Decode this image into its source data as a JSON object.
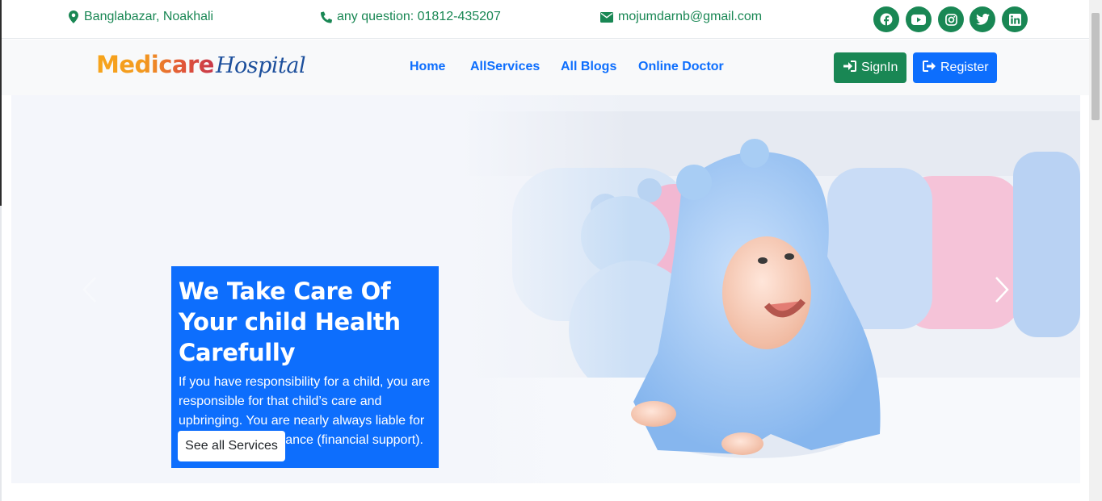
{
  "topbar": {
    "address": "Banglabazar, Noakhali",
    "phone": "any question: 01812-435207",
    "email": "mojumdarnb@gmail.com",
    "social_icons": [
      "facebook-icon",
      "youtube-icon",
      "instagram-icon",
      "twitter-icon",
      "linkedin-icon"
    ]
  },
  "navbar": {
    "brand_part1": "Medicare",
    "brand_part2": "Hospital",
    "links": [
      "Home",
      "AllServices",
      "All Blogs",
      "Online Doctor"
    ],
    "signin_label": "SignIn",
    "register_label": "Register"
  },
  "hero": {
    "title": "We Take Care Of Your child Health Carefully",
    "text": "If you have responsibility for a child, you are responsible for that child’s care and upbringing. You are nearly always liable for the child’s maintenance (financial support).",
    "button_label": "See all Services"
  },
  "colors": {
    "primary": "#0d6efd",
    "success": "#198754",
    "navbar_bg": "#f8f9fa"
  }
}
